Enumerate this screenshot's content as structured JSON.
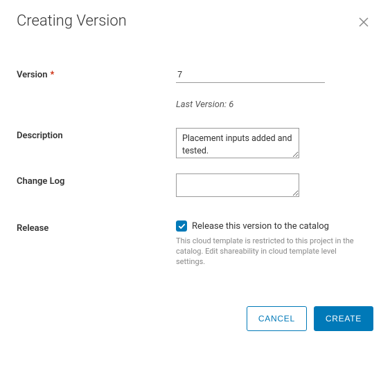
{
  "dialog": {
    "title": "Creating Version"
  },
  "form": {
    "version": {
      "label": "Version",
      "value": "7",
      "hint": "Last Version: 6"
    },
    "description": {
      "label": "Description",
      "value": "Placement inputs added and tested."
    },
    "changelog": {
      "label": "Change Log",
      "value": ""
    },
    "release": {
      "label": "Release",
      "checkbox_label": "Release this version to the catalog",
      "checked": true,
      "help": "This cloud template is restricted to this project in the catalog. Edit shareability in cloud template level settings."
    }
  },
  "footer": {
    "cancel": "Cancel",
    "create": "Create"
  }
}
